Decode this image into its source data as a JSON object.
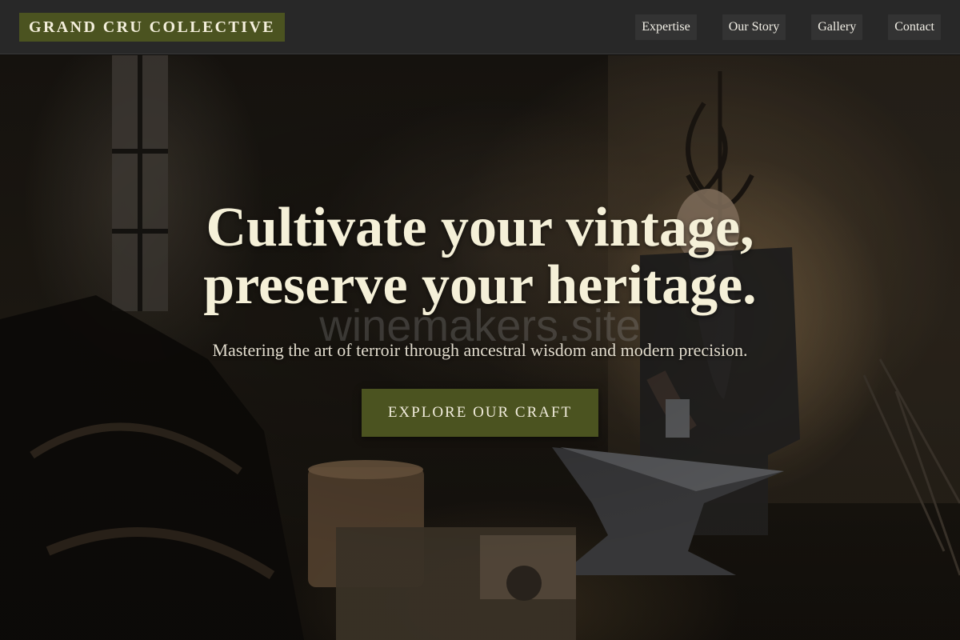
{
  "header": {
    "logo": "GRAND CRU COLLECTIVE",
    "nav": [
      {
        "label": "Expertise"
      },
      {
        "label": "Our Story"
      },
      {
        "label": "Gallery"
      },
      {
        "label": "Contact"
      }
    ]
  },
  "hero": {
    "title_line1": "Cultivate your vintage,",
    "title_line2": "preserve your heritage.",
    "watermark": "winemakers.site",
    "subtitle": "Mastering the art of terroir through ancestral wisdom and modern precision.",
    "cta_label": "EXPLORE OUR CRAFT",
    "background_image": "dim workshop with an elderly bearded blacksmith hammering on an anvil"
  },
  "colors": {
    "header_bg": "#282828",
    "accent_olive": "#4b5320",
    "title_text": "#f5f0d8",
    "nav_item_bg": "#333333"
  }
}
